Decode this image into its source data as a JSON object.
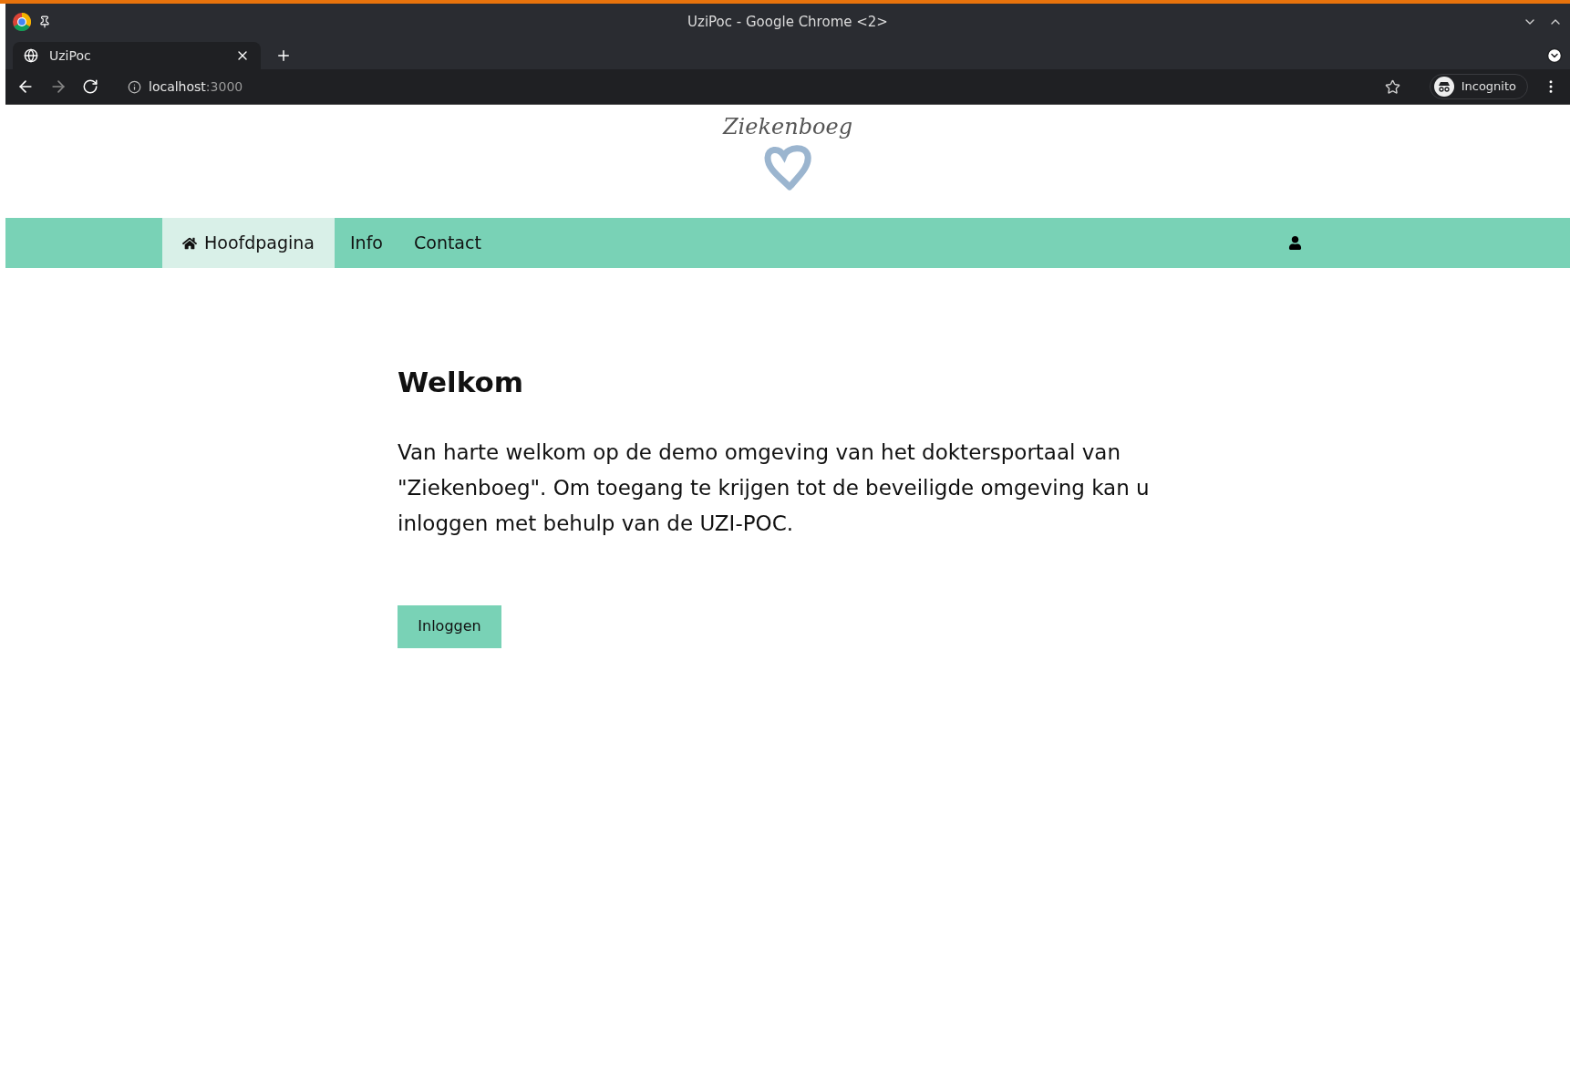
{
  "window": {
    "title": "UziPoc - Google Chrome <2>"
  },
  "tabs": [
    {
      "label": "UziPoc",
      "selected": true
    }
  ],
  "address_bar": {
    "host": "localhost",
    "port": ":3000"
  },
  "profile": {
    "label": "Incognito"
  },
  "logo": {
    "text": "Ziekenboeg"
  },
  "nav": {
    "items": [
      {
        "label": "Hoofdpagina",
        "kind": "home",
        "selected": true
      },
      {
        "label": "Info",
        "kind": "plain",
        "selected": false
      },
      {
        "label": "Contact",
        "kind": "plain",
        "selected": false
      }
    ]
  },
  "content": {
    "heading": "Welkom",
    "paragraph": "Van harte welkom op de demo omgeving van het doktersportaal van \"Ziekenboeg\". Om toegang te krijgen tot de beveiligde omgeving kan u inloggen met behulp van de UZI-POC.",
    "button": "Inloggen"
  }
}
